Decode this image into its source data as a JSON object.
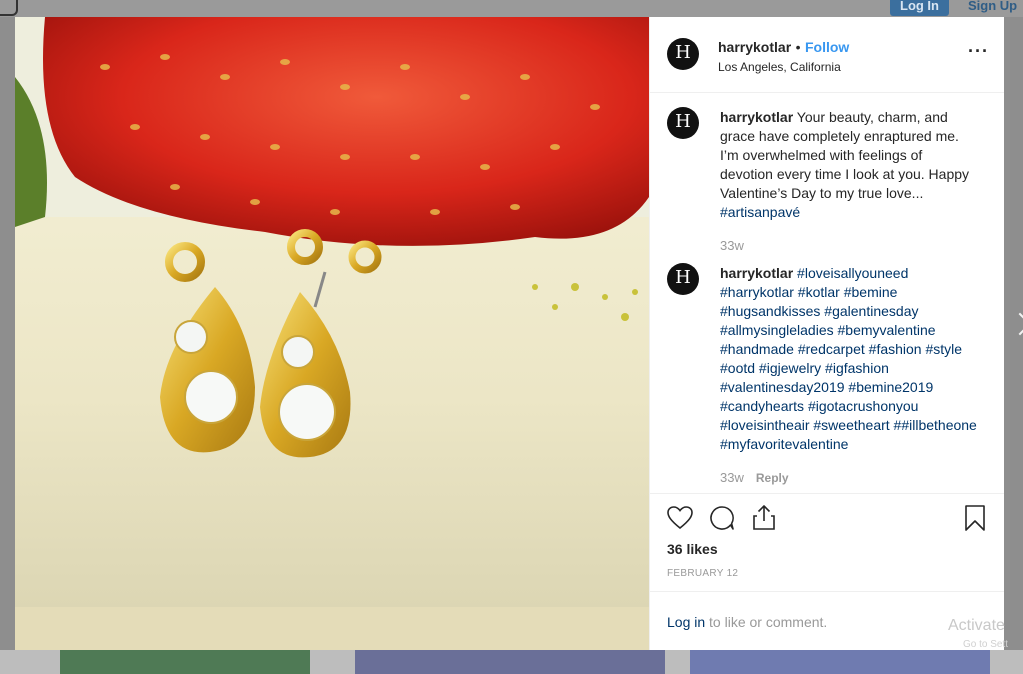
{
  "top_nav": {
    "login_label": "Log In",
    "signup_label": "Sign Up"
  },
  "post": {
    "username": "harrykotlar",
    "separator": "•",
    "follow_label": "Follow",
    "location": "Los Angeles, California",
    "more_label": "···",
    "avatar_letter": "H"
  },
  "comments": [
    {
      "username": "harrykotlar",
      "text": " Your beauty, charm, and grace have completely enraptured me. I’m overwhelmed with feelings of devotion every time I look at you. Happy Valentine’s Day to my true love... ",
      "hashtag": "#artisanpavé",
      "age": "33w"
    },
    {
      "username": "harrykotlar",
      "hashtags_text": "#loveisallyouneed #harrykotlar #kotlar #bemine #hugsandkisses #galentinesday #allmysingleladies #bemyvalentine #handmade #redcarpet #fashion #style #ootd #igjewelry #igfashion #valentinesday2019 #bemine2019 #candyhearts #igotacrushonyou #loveisintheair #sweetheart ##illbetheone #myfavoritevalentine",
      "age": "33w",
      "reply_label": "Reply"
    }
  ],
  "stats": {
    "likes": "36 likes",
    "date": "FEBRUARY 12"
  },
  "footer": {
    "login_link": "Log in",
    "suffix": " to like or comment."
  },
  "icons": {
    "like": "heart-icon",
    "comment": "comment-icon",
    "share": "share-icon",
    "save": "bookmark-icon"
  },
  "os_overlay": {
    "line1": "Activate",
    "line2": "Go to Sett"
  }
}
